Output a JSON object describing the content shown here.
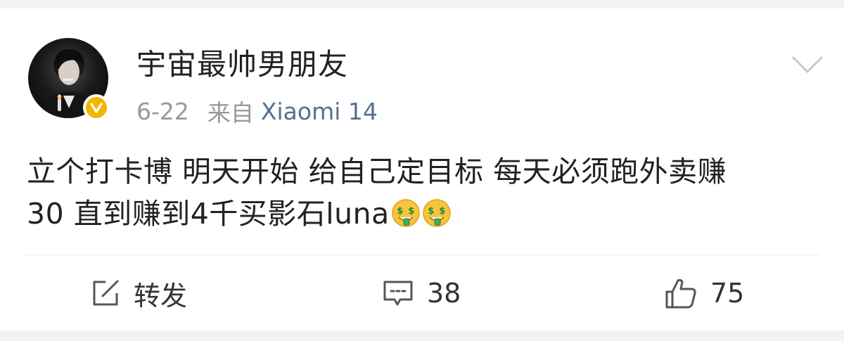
{
  "post": {
    "author": {
      "name": "宇宙最帅男朋友",
      "avatar_icon": "avatar-photo",
      "verified_icon": "verified-v-badge",
      "verified_color": "#f5b400"
    },
    "date": "6-22",
    "source_prefix": "来自",
    "source_device": "Xiaomi 14",
    "text_line1": "立个打卡博 明天开始 给自己定目标 每天必须跑外卖赚",
    "text_line2": "30 直到赚到4千买影石luna",
    "emojis": [
      "money-mouth-face-emoji",
      "money-mouth-face-emoji"
    ]
  },
  "actions": {
    "repost_label": "转发",
    "comment_count": "38",
    "like_count": "75"
  },
  "colors": {
    "device_link": "#596f8e",
    "meta_gray": "#999999",
    "text": "#222222"
  }
}
